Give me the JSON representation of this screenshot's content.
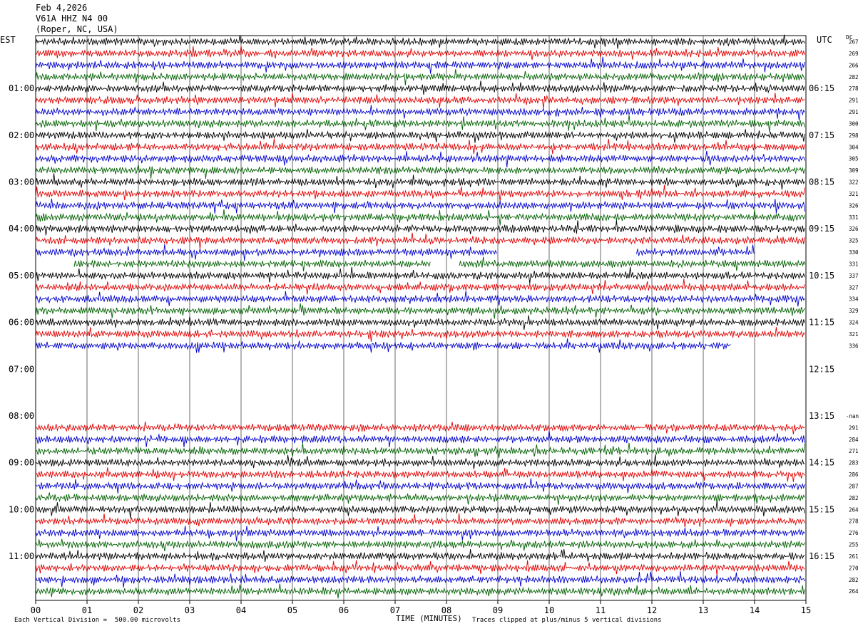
{
  "header": {
    "date": "Feb 4,2026",
    "station": "V61A HHZ N4 00",
    "location": "(Roper, NC, USA)"
  },
  "left_tz": "EST",
  "right_tz": "UTC",
  "dc_label": "DC",
  "footer": {
    "scale": "Each Vertical Division =  500.00 microvolts",
    "clip_note": "Traces clipped at plus/minus 5 vertical divisions"
  },
  "chart_data": {
    "type": "line",
    "title": "",
    "xlabel": "TIME (MINUTES)",
    "ylabel": "",
    "x_ticks": [
      "00",
      "01",
      "02",
      "03",
      "04",
      "05",
      "06",
      "07",
      "08",
      "09",
      "10",
      "11",
      "12",
      "13",
      "14",
      "15"
    ],
    "xlim": [
      0,
      15
    ],
    "row_minutes": 15,
    "colors": [
      "#000000",
      "#e00000",
      "#0000cc",
      "#006000"
    ],
    "left_hour_labels": [
      "01:00",
      "02:00",
      "03:00",
      "04:00",
      "05:00",
      "06:00",
      "07:00",
      "08:00",
      "09:00",
      "10:00",
      "11:00"
    ],
    "right_hour_labels": [
      "06:15",
      "07:15",
      "08:15",
      "09:15",
      "10:15",
      "11:15",
      "12:15",
      "13:15",
      "14:15",
      "15:15",
      "16:15"
    ],
    "traces": [
      {
        "row": 0,
        "dc": "267",
        "start": 0,
        "end": 15,
        "amp": 0.9
      },
      {
        "row": 1,
        "dc": "269",
        "start": 0,
        "end": 15,
        "amp": 0.9
      },
      {
        "row": 2,
        "dc": "266",
        "start": 0,
        "end": 15,
        "amp": 0.9
      },
      {
        "row": 3,
        "dc": "282",
        "start": 0,
        "end": 15,
        "amp": 0.9
      },
      {
        "row": 4,
        "dc": "278",
        "start": 0,
        "end": 15,
        "amp": 0.9
      },
      {
        "row": 5,
        "dc": "291",
        "start": 0,
        "end": 15,
        "amp": 0.9
      },
      {
        "row": 6,
        "dc": "291",
        "start": 0,
        "end": 15,
        "amp": 0.9
      },
      {
        "row": 7,
        "dc": "300",
        "start": 0,
        "end": 15,
        "amp": 0.9
      },
      {
        "row": 8,
        "dc": "298",
        "start": 0,
        "end": 15,
        "amp": 0.9
      },
      {
        "row": 9,
        "dc": "304",
        "start": 0,
        "end": 15,
        "amp": 0.9
      },
      {
        "row": 10,
        "dc": "305",
        "start": 0,
        "end": 15,
        "amp": 0.9
      },
      {
        "row": 11,
        "dc": "309",
        "start": 0,
        "end": 15,
        "amp": 0.9
      },
      {
        "row": 12,
        "dc": "322",
        "start": 0,
        "end": 15,
        "amp": 0.9
      },
      {
        "row": 13,
        "dc": "321",
        "start": 0,
        "end": 15,
        "amp": 0.9
      },
      {
        "row": 14,
        "dc": "326",
        "start": 0,
        "end": 15,
        "amp": 0.9
      },
      {
        "row": 15,
        "dc": "331",
        "start": 0,
        "end": 15,
        "amp": 0.9
      },
      {
        "row": 16,
        "dc": "326",
        "start": 0,
        "end": 15,
        "amp": 0.9
      },
      {
        "row": 17,
        "dc": "325",
        "start": 0,
        "end": 15,
        "amp": 0.9
      },
      {
        "row": 18,
        "dc": "330",
        "start": 0,
        "end": 9.0,
        "amp": 0.9
      },
      {
        "row": 18,
        "dc": "",
        "start": 11.7,
        "end": 14.0,
        "amp": 0.9
      },
      {
        "row": 19,
        "dc": "331",
        "start": 0.75,
        "end": 7.7,
        "amp": 0.9
      },
      {
        "row": 19,
        "dc": "",
        "start": 8.25,
        "end": 15,
        "amp": 0.9
      },
      {
        "row": 20,
        "dc": "337",
        "start": 0,
        "end": 15,
        "amp": 0.9
      },
      {
        "row": 21,
        "dc": "327",
        "start": 0,
        "end": 15,
        "amp": 0.9
      },
      {
        "row": 22,
        "dc": "334",
        "start": 0,
        "end": 15,
        "amp": 0.9
      },
      {
        "row": 23,
        "dc": "329",
        "start": 0,
        "end": 15,
        "amp": 0.9
      },
      {
        "row": 24,
        "dc": "324",
        "start": 0,
        "end": 15,
        "amp": 0.9
      },
      {
        "row": 25,
        "dc": "321",
        "start": 0,
        "end": 15,
        "amp": 0.9
      },
      {
        "row": 26,
        "dc": "336",
        "start": 0,
        "end": 13.55,
        "amp": 0.9
      },
      {
        "row": 33,
        "dc": "291",
        "start": 0,
        "end": 15,
        "amp": 0.9
      },
      {
        "row": 34,
        "dc": "284",
        "start": 0,
        "end": 15,
        "amp": 0.9
      },
      {
        "row": 35,
        "dc": "271",
        "start": 0,
        "end": 15,
        "amp": 0.9
      },
      {
        "row": 36,
        "dc": "283",
        "start": 0,
        "end": 15,
        "amp": 0.9
      },
      {
        "row": 37,
        "dc": "286",
        "start": 0,
        "end": 15,
        "amp": 0.9
      },
      {
        "row": 38,
        "dc": "287",
        "start": 0,
        "end": 15,
        "amp": 0.9
      },
      {
        "row": 39,
        "dc": "282",
        "start": 0,
        "end": 15,
        "amp": 0.9
      },
      {
        "row": 40,
        "dc": "264",
        "start": 0,
        "end": 15,
        "amp": 0.9
      },
      {
        "row": 41,
        "dc": "278",
        "start": 0,
        "end": 15,
        "amp": 0.9
      },
      {
        "row": 42,
        "dc": "276",
        "start": 0,
        "end": 15,
        "amp": 0.9
      },
      {
        "row": 43,
        "dc": "255",
        "start": 0,
        "end": 15,
        "amp": 0.9
      },
      {
        "row": 44,
        "dc": "261",
        "start": 0,
        "end": 15,
        "amp": 0.9
      },
      {
        "row": 45,
        "dc": "270",
        "start": 0,
        "end": 15,
        "amp": 0.9
      },
      {
        "row": 46,
        "dc": "282",
        "start": 0,
        "end": 15,
        "amp": 0.9
      },
      {
        "row": 47,
        "dc": "264",
        "start": 0,
        "end": 15,
        "amp": 0.9
      }
    ],
    "gap_markers": [
      {
        "row": 32,
        "label": "-nan"
      }
    ]
  }
}
